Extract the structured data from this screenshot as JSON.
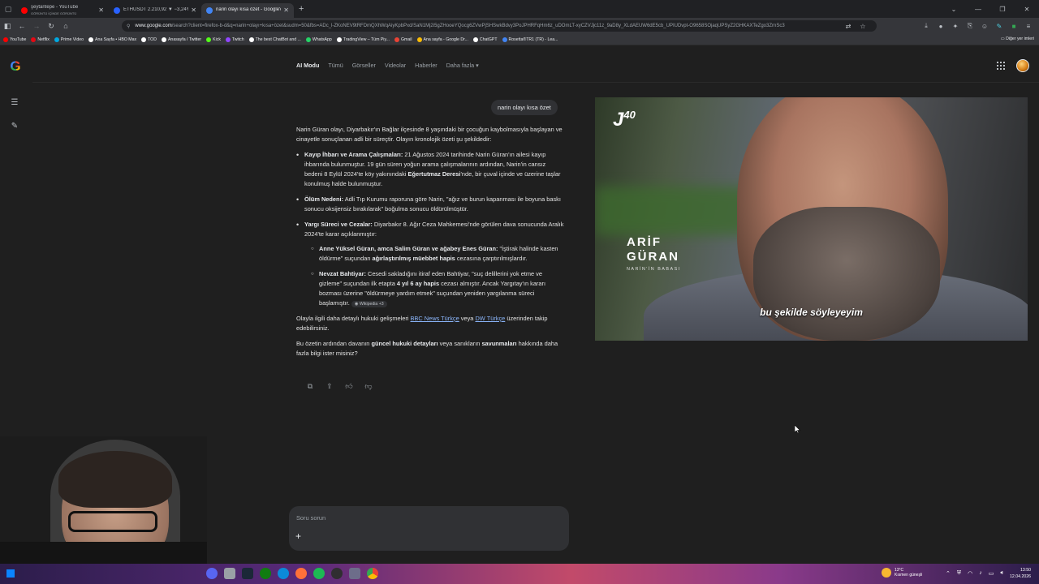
{
  "browser": {
    "tabs": [
      {
        "title": "şeytantepe - YouTube",
        "subtitle": "GÖRÜNTÜ İÇİNDE GÖRÜNTÜ",
        "favicon_color": "#ff0000"
      },
      {
        "title": "ETHUSDT 2.210,92 ▼ −3,24% A",
        "subtitle": "",
        "favicon_color": "#2962ff"
      },
      {
        "title": "narin olayı kısa özet - Google'd",
        "subtitle": "",
        "favicon_color": "#4285f4"
      }
    ],
    "new_tab": "+",
    "url_domain": "www.google.com",
    "url_rest": "/search?client=firefox-b-d&q=narin+olayı+kısa+özet&sudm=50&fbs=ADc_l-ZKoNEV9tRFDmQXhWqAiyKpbPxd/SaN1Mj2i5gZHooeYQocg6ZVwPjSHSwkBdvy3PoJPHRFqHm6z_uDOmLT-xyCZVJjc11z_9aD8y_XLdAEUW6dE5cb_UPIUDvpt-O9658SOjaqUPSyZ2GHKAXTeZgo3ZrnSc3",
    "bookmarks": [
      {
        "label": "YouTube",
        "color": "#ff0000"
      },
      {
        "label": "Netflix",
        "color": "#e50914"
      },
      {
        "label": "Prime Video",
        "color": "#00a8e1"
      },
      {
        "label": "Ana Sayfa • HBO Max",
        "color": "#ffffff"
      },
      {
        "label": "TOD",
        "color": "#ffffff"
      },
      {
        "label": "Anasayfa / Twitter",
        "color": "#ffffff"
      },
      {
        "label": "Kick",
        "color": "#53fc18"
      },
      {
        "label": "Twitch",
        "color": "#9146ff"
      },
      {
        "label": "The best ChatBot and ...",
        "color": "#ffffff"
      },
      {
        "label": "WhatsApp",
        "color": "#25d366"
      },
      {
        "label": "TradingView – Tüm Piy...",
        "color": "#ffffff"
      },
      {
        "label": "Gmail",
        "color": "#ea4335"
      },
      {
        "label": "Ana sayfa - Google Dr...",
        "color": "#fbbc05"
      },
      {
        "label": "ChatGPT",
        "color": "#ffffff"
      },
      {
        "label": "Rosetta®TR1 (TR) - Lea...",
        "color": "#4285f4"
      }
    ],
    "other_bookmarks": "Diğer yer imleri"
  },
  "google": {
    "nav": [
      "AI Modu",
      "Tümü",
      "Görseller",
      "Videolar",
      "Haberler",
      "Daha fazla ▾"
    ],
    "user_query": "narin olayı kısa özet",
    "intro": "Narin Güran olayı, Diyarbakır'ın Bağlar ilçesinde 8 yaşındaki bir çocuğun kaybolmasıyla başlayan ve cinayetle sonuçlanan adli bir süreçtir. Olayın kronolojik özeti şu şekildedir:",
    "bullets": [
      {
        "head": "Kayıp İhbarı ve Arama Çalışmaları:",
        "text_a": " 21 Ağustos 2024 tarihinde Narin Güran'ın ailesi kayıp ihbarında bulunmuştur. 19 gün süren yoğun arama çalışmalarının ardından, Narin'in cansız bedeni 8 Eylül 2024'te köy yakınındaki ",
        "bold_mid": "Eğertutmaz Deresi",
        "text_b": "'nde, bir çuval içinde ve üzerine taşlar konulmuş halde bulunmuştur."
      },
      {
        "head": "Ölüm Nedeni:",
        "text_a": " Adli Tıp Kurumu raporuna göre Narin, \"ağız ve burun kapanması ile boyuna baskı sonucu oksijensiz bırakılarak\" boğulma sonucu öldürülmüştür."
      },
      {
        "head": "Yargı Süreci ve Cezalar:",
        "text_a": " Diyarbakır 8. Ağır Ceza Mahkemesi'nde görülen dava sonucunda Aralık 2024'te karar açıklanmıştır:"
      }
    ],
    "sub_bullets": [
      {
        "head": "Anne Yüksel Güran, amca Salim Güran ve ağabey Enes Güran:",
        "text_a": " \"İştirak halinde kasten öldürme\" suçundan ",
        "bold_mid": "ağırlaştırılmış müebbet hapis",
        "text_b": " cezasına çarptırılmışlardır."
      },
      {
        "head": "Nevzat Bahtiyar:",
        "text_a": " Cesedi sakladığını itiraf eden Bahtiyar, \"suç delillerini yok etme ve gizleme\" suçundan ilk etapta ",
        "bold_mid": "4 yıl 6 ay hapis",
        "text_b": " cezası almıştır. Ancak Yargıtay'ın kararı bozması üzerine \"öldürmeye yardım etmek\" suçundan yeniden yargılanma süreci başlamıştır. ",
        "chip": "Wikipedia +3"
      }
    ],
    "follow_a": "Olayla ilgili daha detaylı hukuki gelişmeleri ",
    "link1": "BBC News Türkçe",
    "follow_b": " veya ",
    "link2": "DW Türkçe",
    "follow_c": " üzerinden takip edebilirsiniz.",
    "closing_a": "Bu özetin ardından davanın ",
    "closing_b1": "güncel hukuki detayları",
    "closing_mid": " veya sanıkların ",
    "closing_b2": "savunmaları",
    "closing_c": " hakkında daha fazla bilgi ister misiniz?",
    "prompt_placeholder": "Soru sorun"
  },
  "video": {
    "channel_logo": "J",
    "channel_sup": "40",
    "person_first": "ARİF",
    "person_last": "GÜRAN",
    "person_role": "NARİN'İN BABASI",
    "subtitle": "bu şekilde söyleyeyim"
  },
  "taskbar": {
    "weather_temp": "13°C",
    "weather_desc": "Kısmen güneşli",
    "time": "13:50",
    "date": "12.04.2026"
  }
}
